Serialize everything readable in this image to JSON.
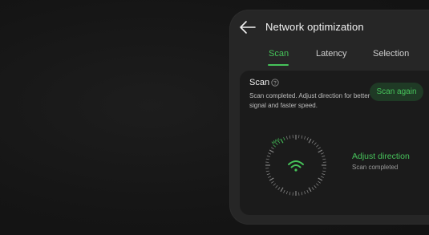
{
  "window": {
    "title": "Network optimization"
  },
  "tabs": [
    {
      "label": "Scan",
      "active": true
    },
    {
      "label": "Latency",
      "active": false
    },
    {
      "label": "Selection",
      "active": false
    }
  ],
  "scan_card": {
    "title": "Scan",
    "description": "Scan completed. Adjust direction for better signal and faster speed.",
    "button_label": "Scan again",
    "dial_label": "MAX",
    "status_title": "Adjust direction",
    "status_subtitle": "Scan completed"
  },
  "icons": {
    "back": "arrow-left-icon",
    "info": "info-circle-icon",
    "signal": "wifi-icon"
  },
  "colors": {
    "accent": "#46c35a",
    "background": "#161616",
    "panel": "#262626",
    "card": "#1b1b1b",
    "button_bg": "#1f3a25"
  }
}
